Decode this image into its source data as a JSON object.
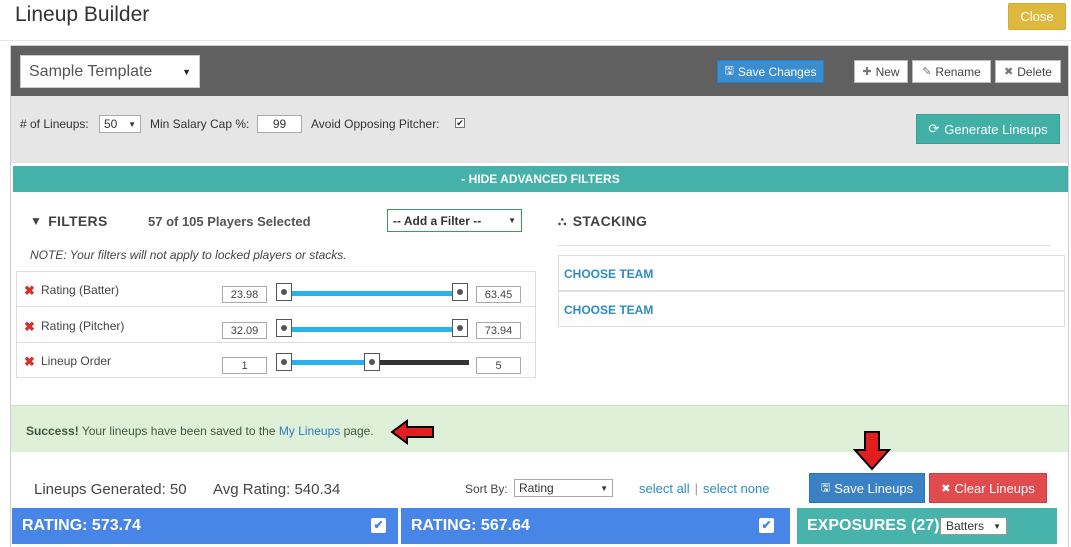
{
  "header": {
    "title": "Lineup Builder",
    "close_label": "Close"
  },
  "toolbar": {
    "template_value": "Sample Template",
    "save_changes_label": "Save Changes",
    "new_label": "New",
    "rename_label": "Rename",
    "delete_label": "Delete"
  },
  "controls": {
    "lineups_label": "# of Lineups:",
    "lineups_value": "50",
    "min_salary_label": "Min Salary Cap %:",
    "min_salary_value": "99",
    "avoid_pitcher_label": "Avoid Opposing Pitcher:",
    "avoid_pitcher_checked": "✔",
    "generate_label": "Generate Lineups"
  },
  "advanced": {
    "toggle_label": "- HIDE ADVANCED FILTERS"
  },
  "filters": {
    "heading": "FILTERS",
    "selected_text": "57 of 105 Players Selected",
    "add_filter_value": "-- Add a Filter --",
    "note": "NOTE: Your filters will not apply to locked players or stacks.",
    "rows": [
      {
        "label": "Rating (Batter)",
        "min": "23.98",
        "max": "63.45"
      },
      {
        "label": "Rating (Pitcher)",
        "min": "32.09",
        "max": "73.94"
      },
      {
        "label": "Lineup Order",
        "min": "1",
        "max": "5"
      }
    ]
  },
  "stacking": {
    "heading": "STACKING",
    "teams": [
      "CHOOSE TEAM",
      "CHOOSE TEAM"
    ]
  },
  "success": {
    "strong": "Success!",
    "text_before": "Your lineups have been saved to the",
    "link": "My Lineups",
    "text_after": "page."
  },
  "results": {
    "generated_text": "Lineups Generated: 50",
    "avg_text": "Avg Rating: 540.34",
    "sort_label": "Sort By:",
    "sort_value": "Rating",
    "select_all": "select all",
    "separator": "|",
    "select_none": "select none",
    "save_lineups_label": "Save Lineups",
    "clear_lineups_label": "Clear Lineups"
  },
  "cards": [
    {
      "rating": "RATING: 573.74"
    },
    {
      "rating": "RATING: 567.64"
    }
  ],
  "exposures": {
    "label": "EXPOSURES (27)",
    "filter_value": "Batters"
  },
  "colors": {
    "accent_teal": "#45b1a9",
    "primary_blue": "#3a82c4",
    "danger_red": "#e04b4e",
    "warning_gold": "#dfb93e",
    "slider_blue": "#29b3ee"
  }
}
